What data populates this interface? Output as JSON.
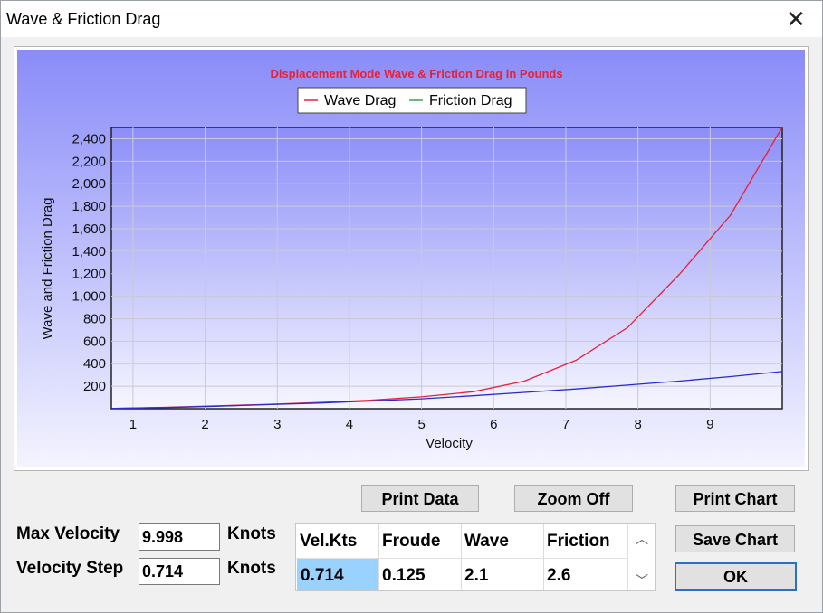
{
  "window": {
    "title": "Wave & Friction Drag",
    "close_glyph": "✕"
  },
  "chart_data": {
    "type": "line",
    "title": "Displacement Mode Wave & Friction Drag in Pounds",
    "xlabel": "Velocity",
    "ylabel": "Wave and Friction Drag",
    "xlim": [
      0.7,
      10.0
    ],
    "ylim": [
      0,
      2500
    ],
    "x_ticks": [
      "1",
      "2",
      "3",
      "4",
      "5",
      "6",
      "7",
      "8",
      "9"
    ],
    "y_ticks": [
      "200",
      "400",
      "600",
      "800",
      "1,000",
      "1,200",
      "1,400",
      "1,600",
      "1,800",
      "2,000",
      "2,200",
      "2,400"
    ],
    "legend": [
      "Wave Drag",
      "Friction Drag"
    ],
    "grid": true,
    "x": [
      0.714,
      1.428,
      2.142,
      2.856,
      3.57,
      4.284,
      4.998,
      5.712,
      6.426,
      7.14,
      7.854,
      8.568,
      9.282,
      9.998
    ],
    "series": [
      {
        "name": "Wave Drag",
        "color": "#e8203a",
        "values": [
          2.1,
          12,
          25,
          38,
          55,
          75,
          105,
          150,
          245,
          430,
          720,
          1190,
          1720,
          2500
        ]
      },
      {
        "name": "Friction Drag",
        "color": "#2c2cc8",
        "values": [
          2.6,
          10,
          22,
          36,
          50,
          68,
          88,
          115,
          145,
          175,
          210,
          245,
          285,
          330
        ]
      }
    ],
    "legend_colors": {
      "Wave Drag": "#e8203a",
      "Friction Drag": "#3aa048"
    }
  },
  "buttons": {
    "print_data": "Print Data",
    "zoom_off": "Zoom Off",
    "print_chart": "Print Chart",
    "save_chart": "Save Chart",
    "ok": "OK"
  },
  "inputs": {
    "max_velocity_label": "Max Velocity",
    "max_velocity_value": "9.998",
    "max_velocity_unit": "Knots",
    "velocity_step_label": "Velocity Step",
    "velocity_step_value": "0.714",
    "velocity_step_unit": "Knots"
  },
  "table": {
    "headers": [
      "Vel.Kts",
      "Froude",
      "Wave",
      "Friction"
    ],
    "row": [
      "0.714",
      "0.125",
      "2.1",
      "2.6"
    ],
    "selected_color": "#99d1ff"
  }
}
